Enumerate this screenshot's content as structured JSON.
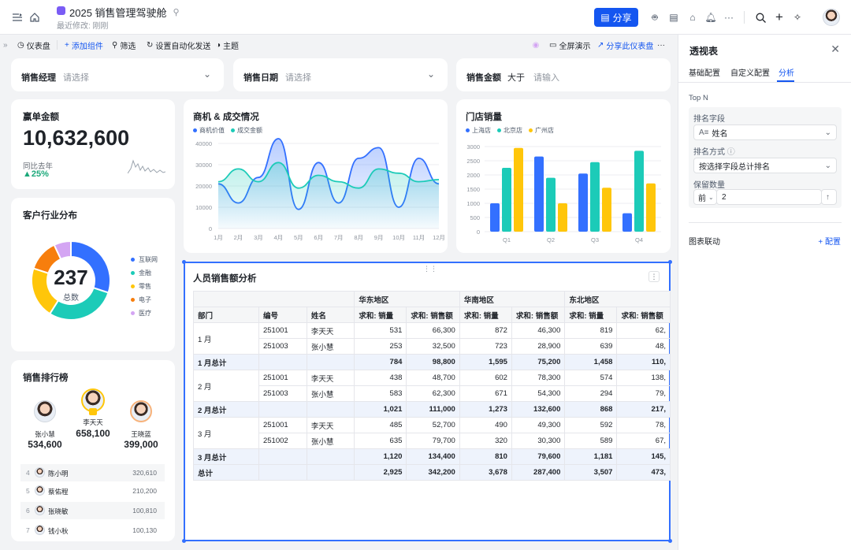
{
  "doc": {
    "title": "2025 销售管理驾驶舱",
    "subtitle": "最近修改: 刚刚",
    "share_label": "分享"
  },
  "toolbar": {
    "dashboard": "仪表盘",
    "add_component": "添加组件",
    "filter": "筛选",
    "automation": "设置自动化发送",
    "theme": "主题",
    "fullscreen": "全屏演示",
    "share_dashboard": "分享此仪表盘"
  },
  "filters": [
    {
      "label": "销售经理",
      "placeholder": "请选择"
    },
    {
      "label": "销售日期",
      "placeholder": "请选择"
    },
    {
      "label": "销售金额",
      "operator": "大于",
      "placeholder": "请输入"
    }
  ],
  "kpi": {
    "title": "赢单金额",
    "value": "10,632,600",
    "compare_label": "同比去年",
    "change": "25%"
  },
  "donut": {
    "title": "客户行业分布",
    "total": "237",
    "total_label": "总数",
    "segments": [
      {
        "name": "互联网",
        "value": 0.3,
        "color": "#3370ff"
      },
      {
        "name": "金融",
        "value": 0.29,
        "color": "#1ccbb8"
      },
      {
        "name": "零售",
        "value": 0.21,
        "color": "#ffc60a"
      },
      {
        "name": "电子",
        "value": 0.13,
        "color": "#f77e0d"
      },
      {
        "name": "医疗",
        "value": 0.07,
        "color": "#d4a5f3"
      }
    ]
  },
  "ranking": {
    "title": "销售排行榜",
    "podium": [
      {
        "name": "张小慧",
        "amount": "534,600"
      },
      {
        "name": "李天天",
        "amount": "658,100"
      },
      {
        "name": "王晓蓝",
        "amount": "399,000"
      }
    ],
    "list": [
      {
        "rank": "4",
        "name": "陈小明",
        "amount": "320,610"
      },
      {
        "rank": "5",
        "name": "蔡佑程",
        "amount": "210,200"
      },
      {
        "rank": "6",
        "name": "张晓敏",
        "amount": "100,810"
      },
      {
        "rank": "7",
        "name": "钱小秋",
        "amount": "100,130"
      }
    ]
  },
  "chart_data": [
    {
      "type": "area",
      "title": "商机 & 成交情况",
      "categories": [
        "1月",
        "2月",
        "3月",
        "4月",
        "5月",
        "6月",
        "7月",
        "8月",
        "9月",
        "10月",
        "11月",
        "12月"
      ],
      "ylim": [
        0,
        40000
      ],
      "yticks": [
        "40000",
        "30000",
        "20000",
        "10000",
        "0"
      ],
      "series": [
        {
          "name": "商机价值",
          "color": "#3370ff",
          "values": [
            21000,
            12000,
            24000,
            43000,
            9000,
            31000,
            12000,
            33000,
            38000,
            10000,
            33000,
            21000
          ]
        },
        {
          "name": "成交金额",
          "color": "#1ccbb8",
          "values": [
            22000,
            28000,
            22000,
            31000,
            19000,
            25000,
            22000,
            19000,
            28000,
            26000,
            22000,
            23000
          ]
        }
      ]
    },
    {
      "type": "bar",
      "title": "门店销量",
      "categories": [
        "Q1",
        "Q2",
        "Q3",
        "Q4"
      ],
      "ylim": [
        0,
        3000
      ],
      "yticks": [
        "3000",
        "2500",
        "2000",
        "1500",
        "1000",
        "500",
        "0"
      ],
      "series": [
        {
          "name": "上海店",
          "color": "#3370ff",
          "values": [
            1000,
            2650,
            2050,
            650
          ]
        },
        {
          "name": "北京店",
          "color": "#1ccbb8",
          "values": [
            2250,
            1900,
            2450,
            2850
          ]
        },
        {
          "name": "广州店",
          "color": "#ffc60a",
          "values": [
            2950,
            1000,
            1550,
            1700
          ]
        }
      ]
    }
  ],
  "pivot": {
    "title": "人员销售额分析",
    "regions": [
      "华东地区",
      "华南地区",
      "东北地区"
    ],
    "headers": [
      "部门",
      "编号",
      "姓名",
      "求和: 销量",
      "求和: 销售额",
      "求和: 销量",
      "求和: 销售额",
      "求和: 销量",
      "求和: 销售额"
    ],
    "rows": [
      [
        "1 月",
        "251001",
        "李天天",
        "531",
        "66,300",
        "872",
        "46,300",
        "819",
        "62,"
      ],
      [
        "",
        "251003",
        "张小慧",
        "253",
        "32,500",
        "723",
        "28,900",
        "639",
        "48,"
      ],
      [
        "1 月总计",
        "",
        "",
        "784",
        "98,800",
        "1,595",
        "75,200",
        "1,458",
        "110,"
      ],
      [
        "2 月",
        "251001",
        "李天天",
        "438",
        "48,700",
        "602",
        "78,300",
        "574",
        "138,"
      ],
      [
        "",
        "251003",
        "张小慧",
        "583",
        "62,300",
        "671",
        "54,300",
        "294",
        "79,"
      ],
      [
        "2 月总计",
        "",
        "",
        "1,021",
        "111,000",
        "1,273",
        "132,600",
        "868",
        "217,"
      ],
      [
        "3 月",
        "251001",
        "李天天",
        "485",
        "52,700",
        "490",
        "49,300",
        "592",
        "78,"
      ],
      [
        "",
        "251002",
        "张小慧",
        "635",
        "79,700",
        "320",
        "30,300",
        "589",
        "67,"
      ],
      [
        "3 月总计",
        "",
        "",
        "1,120",
        "134,400",
        "810",
        "79,600",
        "1,181",
        "145,"
      ],
      [
        "总计",
        "",
        "",
        "2,925",
        "342,200",
        "3,678",
        "287,400",
        "3,507",
        "473,"
      ]
    ]
  },
  "panel": {
    "title": "透视表",
    "tabs": [
      "基础配置",
      "自定义配置",
      "分析"
    ],
    "section": "Top N",
    "sort_field_label": "排名字段",
    "sort_field_value": "姓名",
    "sort_method_label": "排名方式",
    "sort_method_value": "按选择字段总计排名",
    "keep_label": "保留数量",
    "keep_dir": "前",
    "keep_count": "2",
    "linkage_label": "图表联动",
    "config_label": "+ 配置"
  }
}
